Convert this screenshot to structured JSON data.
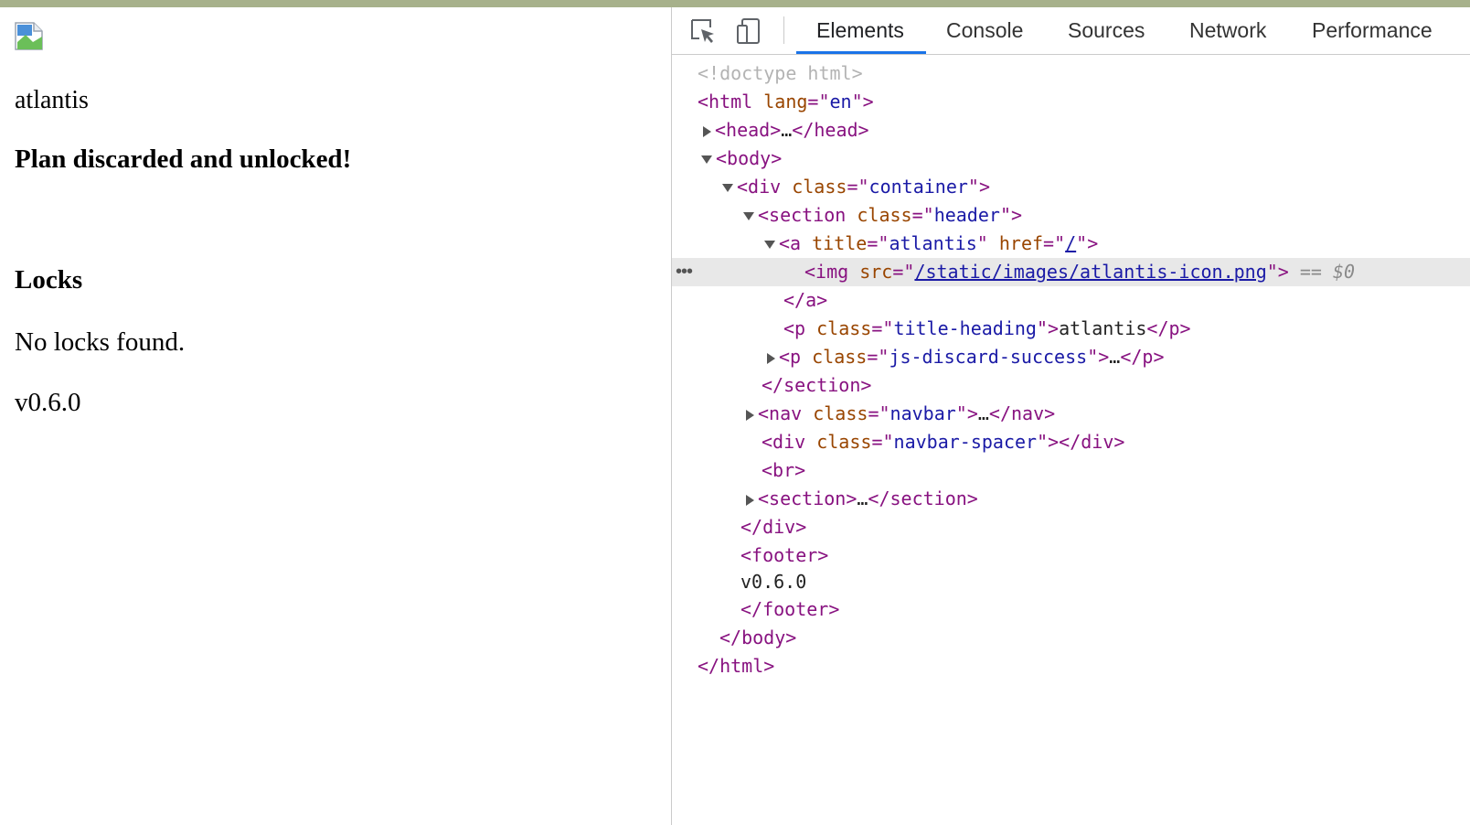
{
  "page": {
    "title": "atlantis",
    "discard_message": "Plan discarded and unlocked!",
    "locks_heading": "Locks",
    "locks_empty": "No locks found.",
    "version": "v0.6.0"
  },
  "devtools": {
    "tabs": [
      "Elements",
      "Console",
      "Sources",
      "Network",
      "Performance"
    ],
    "active_tab": "Elements",
    "icons": [
      "inspect-element-icon",
      "device-toolbar-icon",
      "broken-image-icon"
    ],
    "dom": {
      "doctype": "<!doctype html>",
      "html_lang": "en",
      "head_collapsed": "…",
      "container_class": "container",
      "section_header_class": "header",
      "a_title": "atlantis",
      "a_href": "/",
      "img_src": "/static/images/atlantis-icon.png",
      "selected_marker": "== $0",
      "p_title_class": "title-heading",
      "p_title_text": "atlantis",
      "p_discard_class": "js-discard-success",
      "nav_class": "navbar",
      "spacer_class": "navbar-spacer",
      "footer_text": "v0.6.0",
      "ellipsis": "…"
    }
  }
}
